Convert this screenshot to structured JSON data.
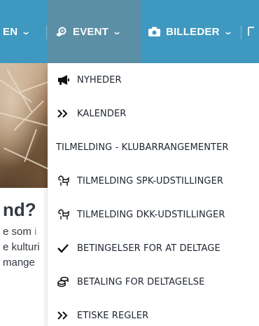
{
  "nav": {
    "items": [
      {
        "label": "EN",
        "icon": "caret-down-icon"
      },
      {
        "label": "EVENT",
        "icon": "gear-hand-icon"
      },
      {
        "label": "BILLEDER",
        "icon": "camera-icon"
      }
    ],
    "bar_color": "#3f98bf",
    "active_color": "#5b8fa6"
  },
  "page": {
    "heading": "nd?",
    "lines": [
      {
        "plain": "e som ",
        "accent": "i"
      },
      {
        "plain": "e kulturi",
        "accent": ""
      },
      {
        "plain": " mange",
        "accent": ""
      }
    ],
    "accent_color": "#b98a3c"
  },
  "dropdown": {
    "items": [
      {
        "label": "NYHEDER",
        "icon": "megaphone-icon"
      },
      {
        "label": "KALENDER",
        "icon": "double-chevron-right-icon"
      },
      {
        "label": "TILMELDING - KLUBARRANGEMENTER",
        "icon": ""
      },
      {
        "label": "TILMELDING SPK-UDSTILLINGER",
        "icon": "dog-icon"
      },
      {
        "label": "TILMELDING DKK-UDSTILLINGER",
        "icon": "dog-icon"
      },
      {
        "label": "BETINGELSER FOR AT DELTAGE",
        "icon": "check-icon"
      },
      {
        "label": "BETALING FOR DELTAGELSE",
        "icon": "coins-icon"
      },
      {
        "label": "ETISKE REGLER",
        "icon": "double-chevron-right-icon"
      }
    ]
  }
}
